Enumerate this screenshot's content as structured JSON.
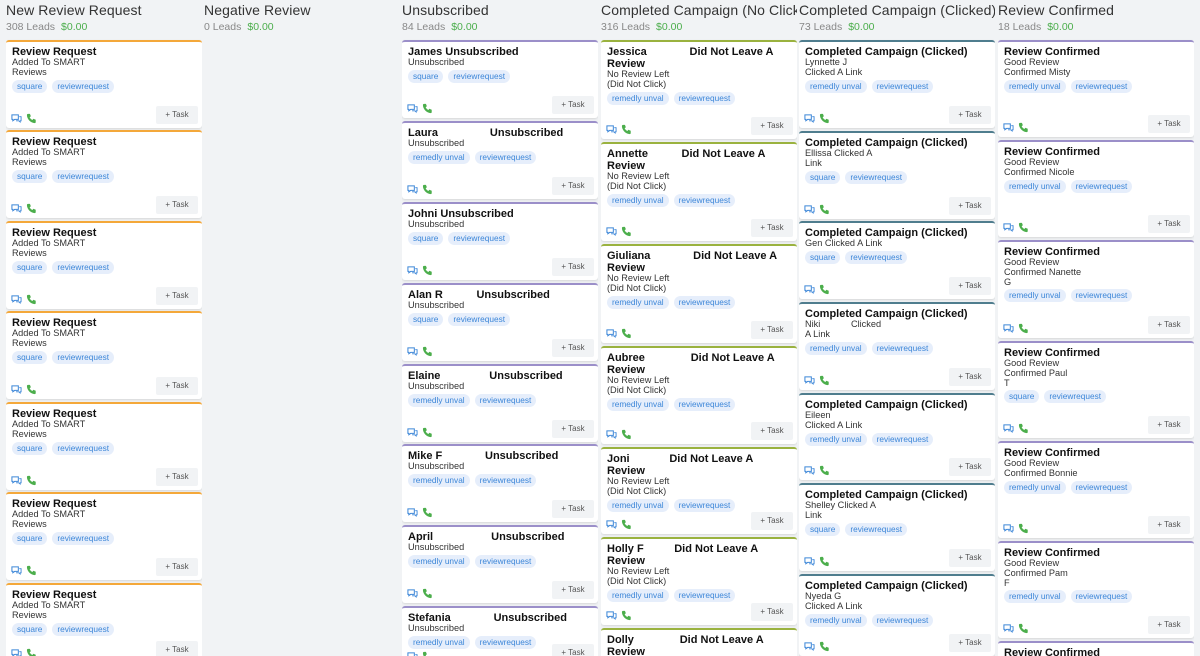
{
  "colors": {
    "orange": "#f4a83a",
    "purple": "#9b8fc9",
    "olive": "#9ab23f",
    "teal": "#4f7d8e",
    "green": "#4cae4c",
    "tag": "#3c86d8"
  },
  "columns": [
    {
      "title": "New Review Request",
      "count": "308 Leads",
      "amount": "$0.00",
      "accent": "orange",
      "cards": [
        {
          "title": "Review Request",
          "sub": "Added To SMART\nReviews",
          "tags": [
            "square",
            "reviewrequest"
          ]
        },
        {
          "title": "Review Request",
          "sub": "Added To SMART\nReviews",
          "tags": [
            "square",
            "reviewrequest"
          ]
        },
        {
          "title": "Review Request",
          "sub": "Added To SMART\nReviews",
          "tags": [
            "square",
            "reviewrequest"
          ]
        },
        {
          "title": "Review Request",
          "sub": "Added To SMART\nReviews",
          "tags": [
            "square",
            "reviewrequest"
          ]
        },
        {
          "title": "Review Request",
          "sub": "Added To SMART\nReviews",
          "tags": [
            "square",
            "reviewrequest"
          ]
        },
        {
          "title": "Review Request",
          "sub": "Added To SMART\nReviews",
          "tags": [
            "square",
            "reviewrequest"
          ]
        },
        {
          "title": "Review Request",
          "sub": "Added To SMART\nReviews",
          "tags": [
            "square",
            "reviewrequest"
          ]
        }
      ]
    },
    {
      "title": "Negative Review",
      "count": "0 Leads",
      "amount": "$0.00",
      "accent": "orange",
      "cards": []
    },
    {
      "title": "Unsubscribed",
      "count": "84 Leads",
      "amount": "$0.00",
      "accent": "purple",
      "cards": [
        {
          "title": "James Unsubscribed",
          "sub": "Unsubscribed",
          "tags": [
            "square",
            "reviewrequest"
          ]
        },
        {
          "title": "Laura                 Unsubscribed",
          "sub": "Unsubscribed",
          "tags": [
            "remedly unval",
            "reviewrequest"
          ]
        },
        {
          "title": "Johni Unsubscribed",
          "sub": "Unsubscribed",
          "tags": [
            "square",
            "reviewrequest"
          ]
        },
        {
          "title": "Alan R           Unsubscribed",
          "sub": "Unsubscribed",
          "tags": [
            "square",
            "reviewrequest"
          ]
        },
        {
          "title": "Elaine                Unsubscribed",
          "sub": "Unsubscribed",
          "tags": [
            "remedly unval",
            "reviewrequest"
          ]
        },
        {
          "title": "Mike F              Unsubscribed",
          "sub": "Unsubscribed",
          "tags": [
            "remedly unval",
            "reviewrequest"
          ]
        },
        {
          "title": "April                   Unsubscribed",
          "sub": "Unsubscribed",
          "tags": [
            "remedly unval",
            "reviewrequest"
          ]
        },
        {
          "title": "Stefania              Unsubscribed",
          "sub": "Unsubscribed",
          "tags": [
            "remedly unval",
            "reviewrequest"
          ]
        }
      ]
    },
    {
      "title": "Completed Campaign (No Click)",
      "count": "316 Leads",
      "amount": "$0.00",
      "accent": "olive",
      "cards": [
        {
          "title": "Jessica              Did Not Leave A\nReview",
          "sub": "No Review Left\n(Did Not Click)",
          "tags": [
            "remedly unval",
            "reviewrequest"
          ]
        },
        {
          "title": "Annette           Did Not Leave A\nReview",
          "sub": "No Review Left\n(Did Not Click)",
          "tags": [
            "remedly unval",
            "reviewrequest"
          ]
        },
        {
          "title": "Giuliana              Did Not Leave A\nReview",
          "sub": "No Review Left\n(Did Not Click)",
          "tags": [
            "remedly unval",
            "reviewrequest"
          ]
        },
        {
          "title": "Aubree               Did Not Leave A\nReview",
          "sub": "No Review Left\n(Did Not Click)",
          "tags": [
            "remedly unval",
            "reviewrequest"
          ]
        },
        {
          "title": "Joni             Did Not Leave A Review",
          "sub": "No Review Left\n(Did Not Click)",
          "tags": [
            "remedly unval",
            "reviewrequest"
          ]
        },
        {
          "title": "Holly F          Did Not Leave A Review",
          "sub": "No Review Left\n(Did Not Click)",
          "tags": [
            "remedly unval",
            "reviewrequest"
          ]
        },
        {
          "title": "Dolly               Did Not Leave A\nReview",
          "sub": "",
          "tags": []
        }
      ]
    },
    {
      "title": "Completed Campaign (Clicked)",
      "count": "73 Leads",
      "amount": "$0.00",
      "accent": "teal",
      "cards": [
        {
          "title": "Completed Campaign (Clicked)",
          "sub": "Lynnette J\nClicked A Link",
          "tags": [
            "remedly unval",
            "reviewrequest"
          ]
        },
        {
          "title": "Completed Campaign (Clicked)",
          "sub": "Ellissa Clicked A\nLink",
          "tags": [
            "square",
            "reviewrequest"
          ]
        },
        {
          "title": "Completed Campaign (Clicked)",
          "sub": "Gen Clicked A Link",
          "tags": [
            "square",
            "reviewrequest"
          ]
        },
        {
          "title": "Completed Campaign (Clicked)",
          "sub": "Niki            Clicked\nA Link",
          "tags": [
            "remedly unval",
            "reviewrequest"
          ]
        },
        {
          "title": "Completed Campaign (Clicked)",
          "sub": "Eileen\nClicked A Link",
          "tags": [
            "remedly unval",
            "reviewrequest"
          ]
        },
        {
          "title": "Completed Campaign (Clicked)",
          "sub": "Shelley Clicked A\nLink",
          "tags": [
            "square",
            "reviewrequest"
          ]
        },
        {
          "title": "Completed Campaign (Clicked)",
          "sub": "Nyeda G\nClicked A Link",
          "tags": [
            "remedly unval",
            "reviewrequest"
          ]
        }
      ]
    },
    {
      "title": "Review Confirmed",
      "count": "18 Leads",
      "amount": "$0.00",
      "accent": "purple",
      "cards": [
        {
          "title": "Review Confirmed",
          "sub": "Good Review\nConfirmed Misty",
          "tags": [
            "remedly unval",
            "reviewrequest"
          ]
        },
        {
          "title": "Review Confirmed",
          "sub": "Good Review\nConfirmed Nicole",
          "tags": [
            "remedly unval",
            "reviewrequest"
          ]
        },
        {
          "title": "Review Confirmed",
          "sub": "Good Review\nConfirmed Nanette\nG",
          "tags": [
            "remedly unval",
            "reviewrequest"
          ]
        },
        {
          "title": "Review Confirmed",
          "sub": "Good Review\nConfirmed Paul\nT",
          "tags": [
            "square",
            "reviewrequest"
          ]
        },
        {
          "title": "Review Confirmed",
          "sub": "Good Review\nConfirmed Bonnie",
          "tags": [
            "remedly unval",
            "reviewrequest"
          ]
        },
        {
          "title": "Review Confirmed",
          "sub": "Good Review\nConfirmed Pam\nF",
          "tags": [
            "remedly unval",
            "reviewrequest"
          ]
        },
        {
          "title": "Review Confirmed",
          "sub": "",
          "tags": []
        }
      ]
    }
  ],
  "task_label": "+ Task"
}
